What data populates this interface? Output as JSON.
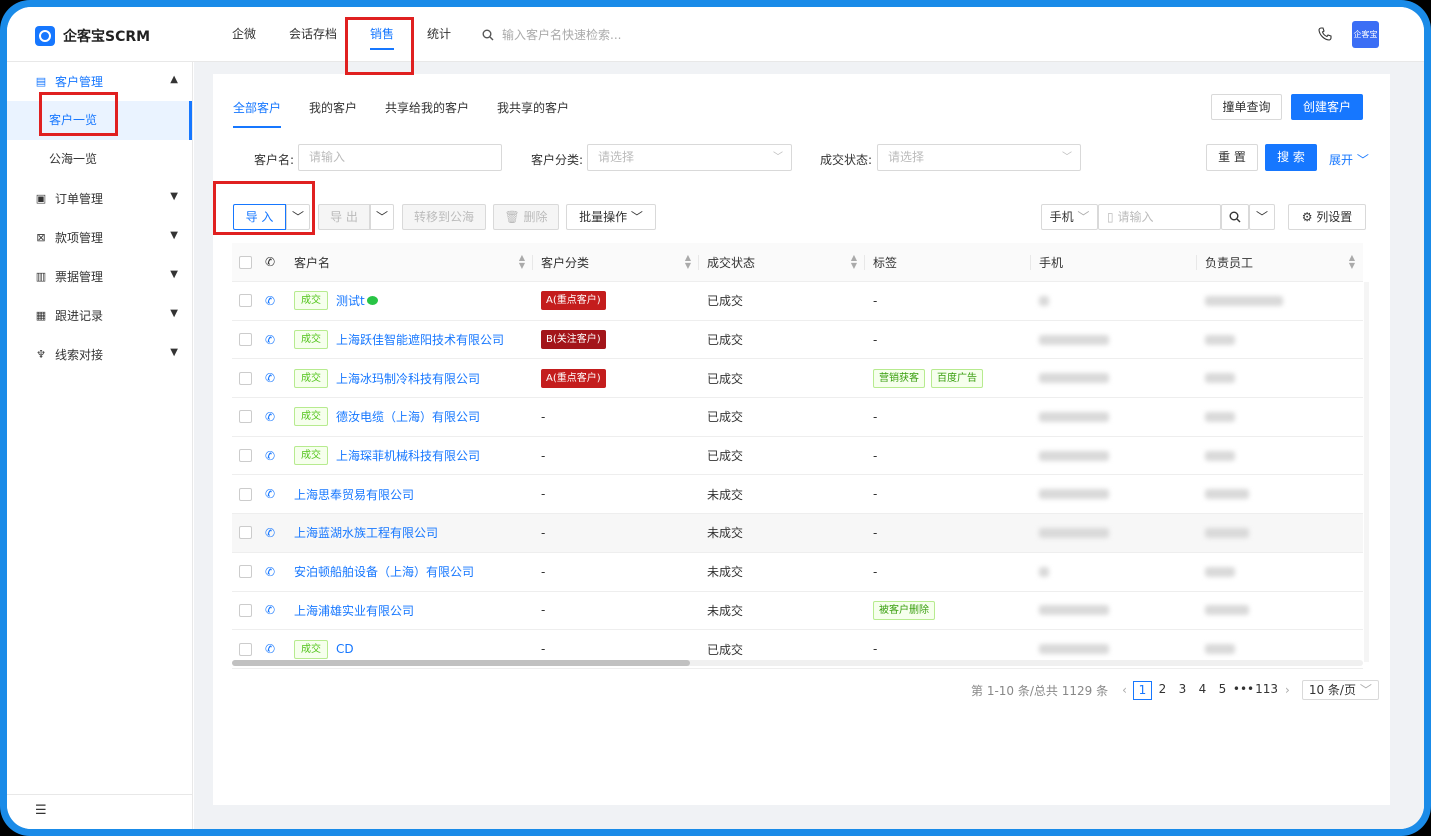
{
  "app": {
    "logo_text": "企客宝SCRM",
    "avatar_text": "企客宝"
  },
  "topnav": [
    "企微",
    "会话存档",
    "销售",
    "统计"
  ],
  "top_search": {
    "placeholder": "输入客户名快速检索..."
  },
  "sidebar": {
    "groups": [
      {
        "label": "客户管理",
        "icon": "building-icon",
        "open": true,
        "items": [
          "客户一览",
          "公海一览"
        ]
      },
      {
        "label": "订单管理",
        "icon": "order-icon"
      },
      {
        "label": "款项管理",
        "icon": "payment-icon"
      },
      {
        "label": "票据管理",
        "icon": "invoice-icon"
      },
      {
        "label": "跟进记录",
        "icon": "record-icon"
      },
      {
        "label": "线索对接",
        "icon": "lead-icon"
      }
    ]
  },
  "tabs": [
    "全部客户",
    "我的客户",
    "共享给我的客户",
    "我共享的客户"
  ],
  "header_buttons": {
    "check": "撞单查询",
    "create": "创建客户"
  },
  "filters": {
    "name_label": "客户名:",
    "name_placeholder": "请输入",
    "category_label": "客户分类:",
    "category_placeholder": "请选择",
    "status_label": "成交状态:",
    "status_placeholder": "请选择",
    "reset": "重 置",
    "search": "搜 索",
    "expand": "展开"
  },
  "toolbar": {
    "import": "导 入",
    "export": "导 出",
    "transfer": "转移到公海",
    "delete": "删除",
    "batch": "批量操作",
    "phone_select": "手机",
    "phone_placeholder": "请输入",
    "columns": "列设置"
  },
  "table": {
    "headers": [
      "客户名",
      "客户分类",
      "成交状态",
      "标签",
      "手机",
      "负责员工"
    ],
    "rows": [
      {
        "deal": "成交",
        "name": "测试t",
        "wechat": true,
        "category": "A(重点客户)",
        "cat_class": "a",
        "status": "已成交",
        "labels": [],
        "label_dash": "-"
      },
      {
        "deal": "成交",
        "name": "上海跃佳智能遮阳技术有限公司",
        "category": "B(关注客户)",
        "cat_class": "b",
        "status": "已成交",
        "labels": [],
        "label_dash": "-"
      },
      {
        "deal": "成交",
        "name": "上海冰玛制冷科技有限公司",
        "category": "A(重点客户)",
        "cat_class": "a",
        "status": "已成交",
        "labels": [
          "营销获客",
          "百度广告"
        ],
        "label_dash": ""
      },
      {
        "deal": "成交",
        "name": "德汝电缆（上海）有限公司",
        "category": "-",
        "status": "已成交",
        "labels": [],
        "label_dash": "-"
      },
      {
        "deal": "成交",
        "name": "上海琛菲机械科技有限公司",
        "category": "-",
        "status": "已成交",
        "labels": [],
        "label_dash": "-"
      },
      {
        "deal": "",
        "name": "上海思奉贸易有限公司",
        "category": "-",
        "status": "未成交",
        "labels": [],
        "label_dash": "-"
      },
      {
        "deal": "",
        "name": "上海蓝湖水族工程有限公司",
        "category": "-",
        "status": "未成交",
        "labels": [],
        "label_dash": "-"
      },
      {
        "deal": "",
        "name": "安泊顿船舶设备（上海）有限公司",
        "category": "-",
        "status": "未成交",
        "labels": [],
        "label_dash": "-"
      },
      {
        "deal": "",
        "name": "上海浦雄实业有限公司",
        "category": "-",
        "status": "未成交",
        "labels": [
          "被客户删除"
        ],
        "label_dash": ""
      },
      {
        "deal": "成交",
        "name": "CD",
        "category": "-",
        "status": "已成交",
        "labels": [],
        "label_dash": "-"
      }
    ]
  },
  "pagination": {
    "total_text": "第 1-10 条/总共 1129 条",
    "pages": [
      "1",
      "2",
      "3",
      "4",
      "5",
      "•••",
      "113"
    ],
    "active": "1",
    "page_size": "10 条/页"
  },
  "colors": {
    "accent": "#1677ff",
    "highlight": "#e02020",
    "frame": "#1a8be8"
  }
}
